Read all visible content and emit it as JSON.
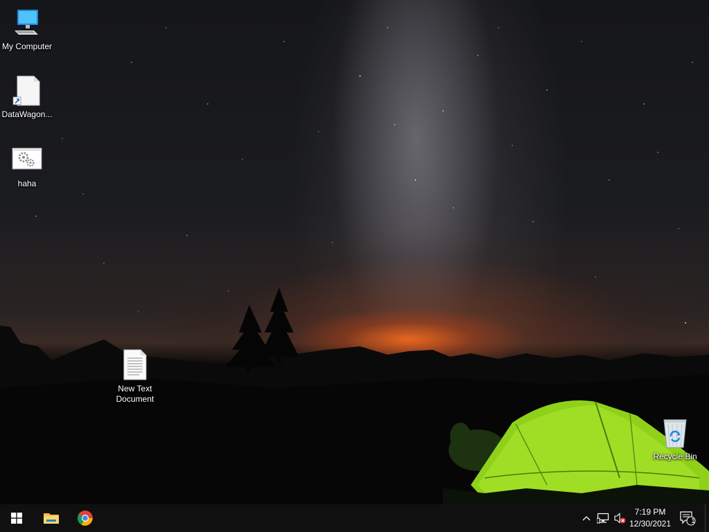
{
  "desktop": {
    "icons": [
      {
        "label": "My Computer",
        "icon": "computer-icon"
      },
      {
        "label": "DataWagon...",
        "icon": "file-shortcut-icon"
      },
      {
        "label": "haha",
        "icon": "settings-window-icon"
      },
      {
        "label": "New Text Document",
        "icon": "text-document-icon"
      },
      {
        "label": "Recycle Bin",
        "icon": "recycle-bin-icon"
      }
    ]
  },
  "taskbar": {
    "start_icon": "windows-logo-icon",
    "pinned": [
      {
        "name": "File Explorer",
        "icon": "folder-icon"
      },
      {
        "name": "Google Chrome",
        "icon": "chrome-icon"
      }
    ],
    "tray": {
      "icons": [
        "chevron-up-icon",
        "network-icon",
        "volume-muted-icon"
      ],
      "time": "7:19 PM",
      "date": "12/30/2021",
      "notification_count": "1"
    }
  },
  "colors": {
    "taskbar": "#101010",
    "tent": "#8fd11a",
    "horizon_glow": "#ff6a1e"
  }
}
